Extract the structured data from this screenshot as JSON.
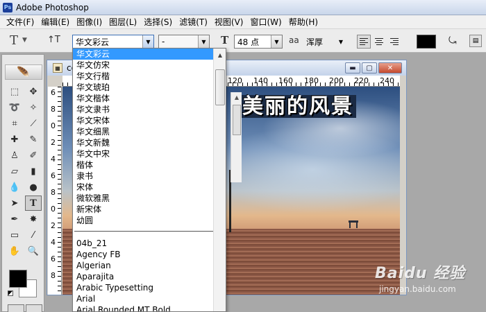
{
  "app": {
    "title": "Adobe Photoshop",
    "icon": "Ps"
  },
  "menu": [
    "文件(F)",
    "编辑(E)",
    "图像(I)",
    "图层(L)",
    "选择(S)",
    "滤镜(T)",
    "视图(V)",
    "窗口(W)",
    "帮助(H)"
  ],
  "options_bar": {
    "tool_preset_glyph": "T",
    "orient_glyph": "↑T",
    "font_family": "华文彩云",
    "font_style": "-",
    "size_glyph": "T",
    "font_size": "48 点",
    "aa_glyph": "aa",
    "antialias": "浑厚",
    "text_color": "#000000"
  },
  "document": {
    "title_partial": "co",
    "ruler_labels": [
      "120",
      "140",
      "160",
      "180",
      "200",
      "220",
      "240"
    ],
    "left_ruler_labels": [
      "6",
      "8",
      "0",
      "2",
      "4",
      "6",
      "8",
      "0",
      "2",
      "4",
      "6",
      "8"
    ],
    "canvas_text": "美丽的风景"
  },
  "font_dropdown": {
    "cjk_fonts": [
      "华文彩云",
      "华文仿宋",
      "华文行楷",
      "华文琥珀",
      "华文楷体",
      "华文隶书",
      "华文宋体",
      "华文细黑",
      "华文新魏",
      "华文中宋",
      "楷体",
      "隶书",
      "宋体",
      "微软雅黑",
      "新宋体",
      "幼圆"
    ],
    "latin_fonts": [
      "04b_21",
      "Agency FB",
      "Algerian",
      "Aparajita",
      "Arabic Typesetting",
      "Arial",
      "Arial Rounded MT Bold"
    ],
    "selected": "华文彩云"
  },
  "watermark": {
    "logo": "Baidu 经验",
    "sub": "jingyan.baidu.com"
  }
}
